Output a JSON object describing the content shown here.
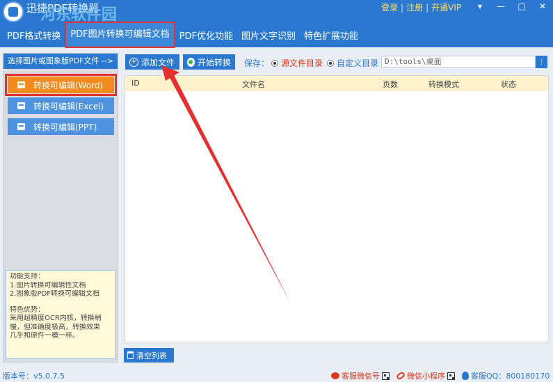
{
  "titlebar": {
    "title": "迅捷PDF转换器",
    "watermark": "河东软件园",
    "login": "登录",
    "sep": "|",
    "register": "注册",
    "vip": "开通VIP",
    "menu_icon": "▾",
    "minimize_icon": "—",
    "maximize_icon": "□",
    "close_icon": "✕"
  },
  "menu": {
    "tabs": [
      {
        "label": "PDF格式转换"
      },
      {
        "label": "PDF图片转换可编辑文档"
      },
      {
        "label": "PDF优化功能"
      },
      {
        "label": "图片文字识别"
      },
      {
        "label": "特色扩展功能"
      }
    ]
  },
  "left_panel": {
    "header": "选择图片或图象版PDF文件 -->",
    "buttons": [
      {
        "label": "转换可编辑(Word)"
      },
      {
        "label": "转换可编辑(Excel)"
      },
      {
        "label": "转换可编辑(PPT)"
      }
    ],
    "info": {
      "line1": "功能支持：",
      "line2": "1.图片转换可编辑性文档",
      "line3": "2.图象版PDF转换可编辑文档",
      "line4": "特色优势：",
      "line5": "采用超精度OCR内核，转换稍",
      "line6": "慢，但准确度极高，转换效果",
      "line7": "几乎和原件一模一样。"
    }
  },
  "toolbar": {
    "add_file": "添加文件",
    "start_convert": "开始转换",
    "save_label": "保存：",
    "radio_source": "源文件目录",
    "radio_custom": "自定义目录",
    "path_value": "D:\\tools\\桌面",
    "browse_icon": "⋮"
  },
  "table": {
    "columns": [
      "ID",
      "文件名",
      "页数",
      "转换模式",
      "状态"
    ]
  },
  "clear_list": "清空列表",
  "statusbar": {
    "version": "版本号：v5.0.7.5",
    "wechat_service": "客服微信号",
    "mini_program": "微信小程序",
    "qq_service": "客服QQ：800180170"
  },
  "colors": {
    "primary": "#2a78cf",
    "active_tab_border": "#e53030",
    "active_button": "#f28a1e",
    "annotation_arrow": "#e53030"
  }
}
